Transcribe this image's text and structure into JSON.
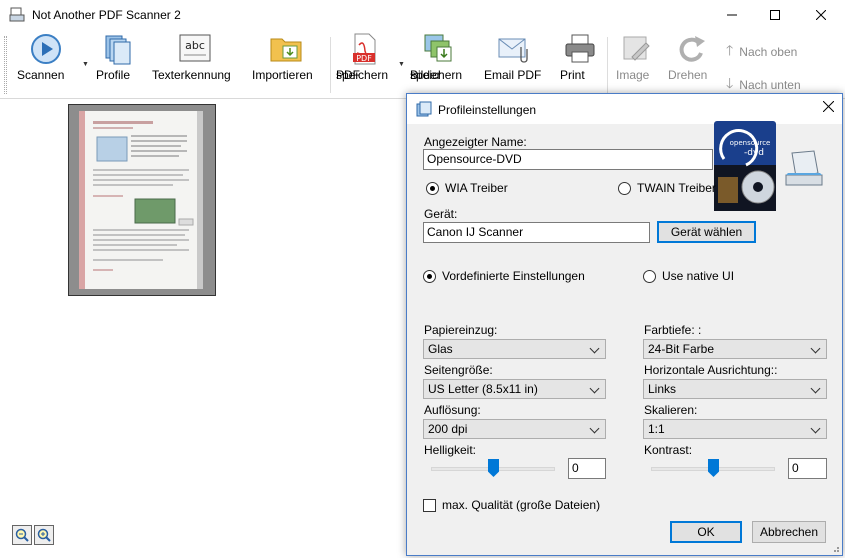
{
  "window": {
    "title": "Not Another PDF Scanner 2",
    "minimize": "—",
    "maximize": "☐",
    "close": "✕"
  },
  "toolbar": {
    "scan": "Scannen",
    "profiles": "Profile",
    "ocr": "Texterkennung",
    "import": "Importieren",
    "save_pdf_line1": "PDF",
    "save_pdf_line2": "speichern",
    "save_images_line1": "Bilder",
    "save_images_line2": "speichern",
    "email_pdf": "Email PDF",
    "print": "Print",
    "image": "Image",
    "rotate": "Drehen",
    "move_up": "Nach oben",
    "move_down": "Nach unten",
    "pdf_badge": "PDF",
    "abc_badge": "abc"
  },
  "dialog": {
    "title": "Profileinstellungen",
    "display_name_label": "Angezeigter Name:",
    "display_name_value": "Opensource-DVD",
    "wia_driver": "WIA Treiber",
    "twain_driver": "TWAIN Treiber",
    "device_label": "Gerät:",
    "device_value": "Canon IJ Scanner",
    "choose_device": "Gerät wählen",
    "predefined_settings": "Vordefinierte Einstellungen",
    "native_ui": "Use native UI",
    "paper_source_label": "Papiereinzug:",
    "paper_source_value": "Glas",
    "bit_depth_label": "Farbtiefe: :",
    "bit_depth_value": "24-Bit Farbe",
    "page_size_label": "Seitengröße:",
    "page_size_value": "US Letter (8.5x11 in)",
    "h_align_label": "Horizontale Ausrichtung::",
    "h_align_value": "Links",
    "resolution_label": "Auflösung:",
    "resolution_value": "200 dpi",
    "scale_label": "Skalieren:",
    "scale_value": "1:1",
    "brightness_label": "Helligkeit:",
    "brightness_value": "0",
    "brightness_level": 0.5,
    "contrast_label": "Kontrast:",
    "contrast_value": "0",
    "contrast_level": 0.5,
    "max_quality": "max. Qualität (große Dateien)",
    "ok": "OK",
    "cancel": "Abbrechen",
    "dvd_logo_line1": "opensource",
    "dvd_logo_line2": "-dvd"
  },
  "colors": {
    "accent": "#0078d7",
    "pdf_red": "#d9302c"
  }
}
